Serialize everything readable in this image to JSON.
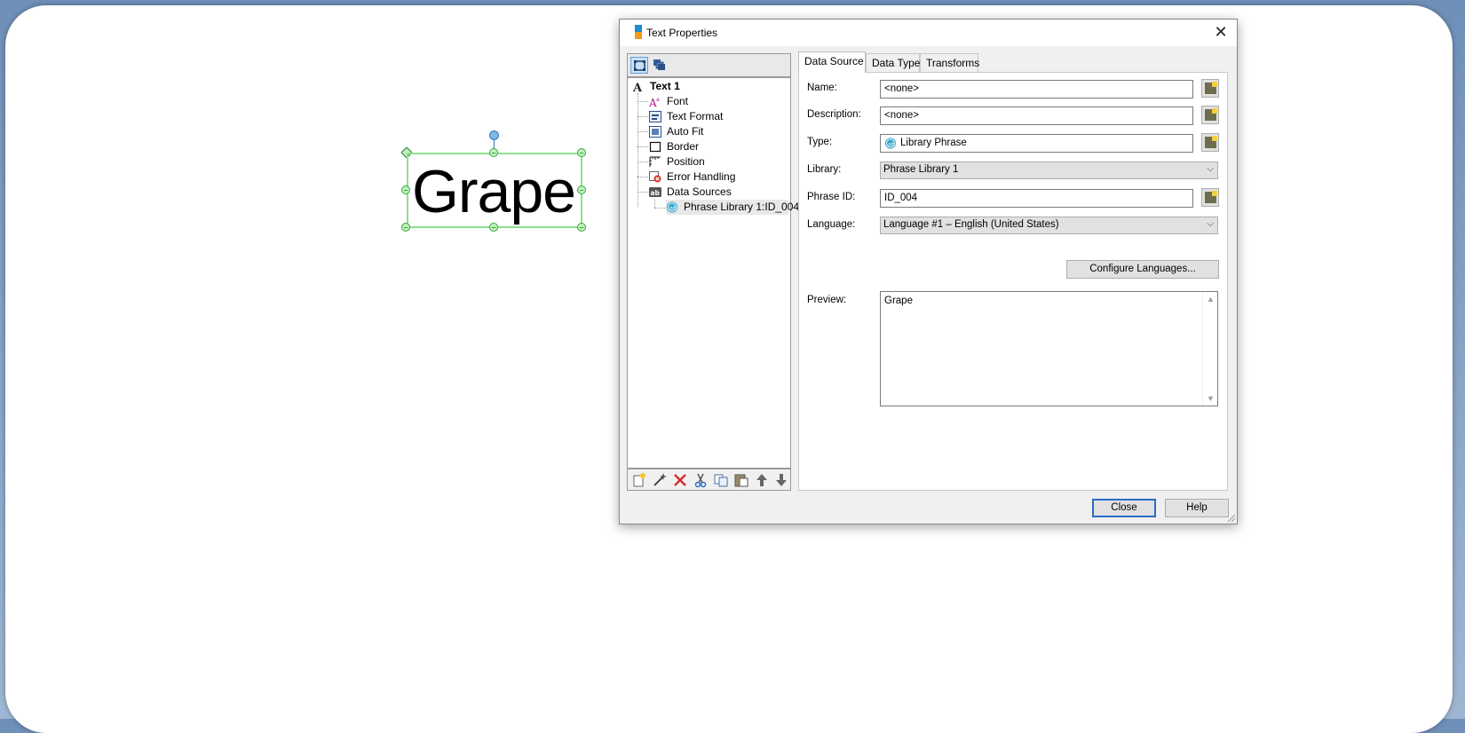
{
  "canvas": {
    "object_text": "Grape"
  },
  "dialog": {
    "title": "Text Properties",
    "close_glyph": "✕"
  },
  "tree": {
    "root": "Text 1",
    "items": [
      {
        "label": "Font",
        "icon": "font-icon"
      },
      {
        "label": "Text Format",
        "icon": "text-format-icon"
      },
      {
        "label": "Auto Fit",
        "icon": "auto-fit-icon"
      },
      {
        "label": "Border",
        "icon": "border-icon"
      },
      {
        "label": "Position",
        "icon": "position-icon"
      },
      {
        "label": "Error Handling",
        "icon": "error-handling-icon"
      },
      {
        "label": "Data Sources",
        "icon": "data-sources-icon"
      }
    ],
    "child": "Phrase Library 1:ID_004"
  },
  "tabs": [
    {
      "label": "Data Source",
      "active": true
    },
    {
      "label": "Data Type",
      "active": false
    },
    {
      "label": "Transforms",
      "active": false
    }
  ],
  "form": {
    "name_label": "Name:",
    "name_value": "<none>",
    "description_label": "Description:",
    "description_value": "<none>",
    "type_label": "Type:",
    "type_value": "Library Phrase",
    "library_label": "Library:",
    "library_value": "Phrase Library 1",
    "phrase_id_label": "Phrase ID:",
    "phrase_id_value": "ID_004",
    "language_label": "Language:",
    "language_value": "Language #1 – English (United States)",
    "configure_languages": "Configure Languages...",
    "preview_label": "Preview:",
    "preview_value": "Grape"
  },
  "buttons": {
    "close": "Close",
    "help": "Help"
  },
  "colors": {
    "selection_green": "#8ee08e",
    "accent_blue": "#2a6cc9"
  }
}
